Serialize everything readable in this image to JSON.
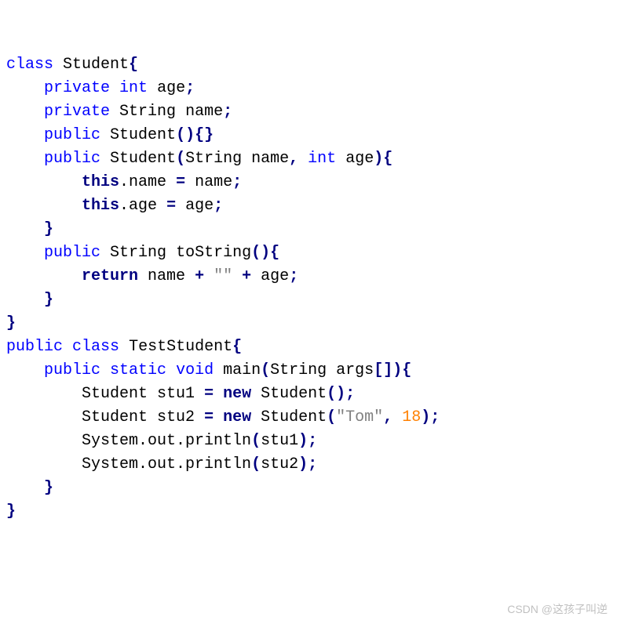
{
  "class1": {
    "keyword": "class",
    "name": "Student",
    "field1": {
      "mod": "private",
      "type": "int",
      "name": "age"
    },
    "field2": {
      "mod": "private",
      "type": "String",
      "name": "name"
    },
    "ctor1": {
      "mod": "public",
      "name": "Student"
    },
    "ctor2": {
      "mod": "public",
      "name": "Student",
      "p1type": "String",
      "p1name": "name",
      "p2type": "int",
      "p2name": "age",
      "assign1_lhs": ".name",
      "assign1_rhs": "name",
      "assign2_lhs": ".age",
      "assign2_rhs": "age"
    },
    "method1": {
      "mod": "public",
      "ret": "String",
      "name": "toString",
      "ret_expr_a": "name",
      "ret_plus1": "+",
      "ret_str": "\"\"",
      "ret_plus2": "+",
      "ret_expr_b": "age"
    }
  },
  "class2": {
    "mod": "public",
    "keyword": "class",
    "name": "TestStudent",
    "main": {
      "mod": "public",
      "static": "static",
      "ret": "void",
      "name": "main",
      "ptype": "String",
      "pname": "args",
      "l1": {
        "type": "Student",
        "var": "stu1",
        "new": "new",
        "ctor": "Student"
      },
      "l2": {
        "type": "Student",
        "var": "stu2",
        "new": "new",
        "ctor": "Student",
        "arg_str": "\"Tom\"",
        "arg_num": "18"
      },
      "l3": {
        "call": "System.out.println",
        "arg": "stu1"
      },
      "l4": {
        "call": "System.out.println",
        "arg": "stu2"
      }
    }
  },
  "kw": {
    "this": "this",
    "return": "return"
  },
  "watermark": "CSDN @这孩子叫逆"
}
